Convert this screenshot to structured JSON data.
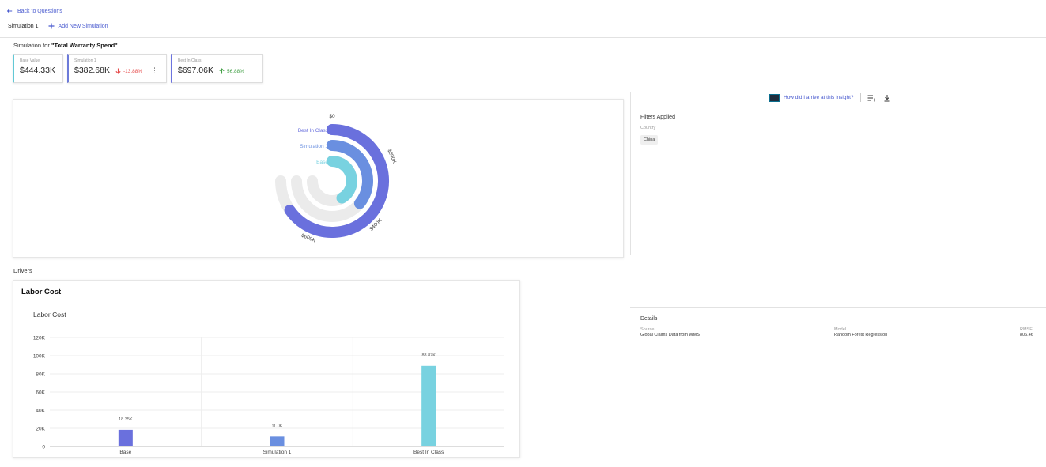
{
  "nav": {
    "back_label": "Back to Questions"
  },
  "tabs": {
    "active": "Simulation 1",
    "add_label": "Add New Simulation"
  },
  "simulation": {
    "prefix": "Simulation for ",
    "metric": "\"Total Warranty Spend\""
  },
  "kpis": [
    {
      "label": "Base Value",
      "value": "$444.33K",
      "change": "",
      "accent": "#62c9d6"
    },
    {
      "label": "Simulation 1",
      "value": "$382.68K",
      "change": "-13.88%",
      "direction": "down",
      "accent": "#6c7ad9"
    },
    {
      "label": "Best In Class",
      "value": "$697.06K",
      "change": "56.88%",
      "direction": "up",
      "accent": "#6c74df"
    }
  ],
  "insight": {
    "link_label": "How did I arrive at this insight?"
  },
  "filters": {
    "heading": "Filters Applied",
    "key": "Country",
    "value": "China"
  },
  "drivers_label": "Drivers",
  "details": {
    "heading": "Details",
    "source_key": "Source",
    "source_value": "Global Claims Data from WMS",
    "model_key": "Model",
    "model_value": "Random Forest Regression",
    "rmse_key": "RMSE",
    "rmse_value": "806.46"
  },
  "driver_card": {
    "title": "Labor Cost"
  },
  "colors": {
    "base": "#78d2e0",
    "simulation": "#6a8fe0",
    "best": "#6a70dd",
    "track": "#ebebeb",
    "link": "#4a5bcf"
  },
  "chart_data": [
    {
      "type": "radial-bar",
      "series": [
        {
          "name": "Best In Class",
          "value": 697.06
        },
        {
          "name": "Simulation 1",
          "value": 382.68
        },
        {
          "name": "Base",
          "value": 444.33
        }
      ],
      "axis_labels": [
        "$0",
        "$200K",
        "$400K",
        "$600K"
      ],
      "axis_max": 800
    },
    {
      "type": "bar",
      "title": "Labor Cost",
      "categories": [
        "Base",
        "Simulation 1",
        "Best In Class"
      ],
      "values": [
        18.35,
        11.0,
        88.87
      ],
      "data_labels": [
        "18.35K",
        "11.0K",
        "88.87K"
      ],
      "colors": [
        "#6a70dd",
        "#6a8fe0",
        "#78d2e0"
      ],
      "yticks": [
        "0",
        "20K",
        "40K",
        "60K",
        "80K",
        "100K",
        "120K"
      ],
      "ylim": [
        0,
        120
      ],
      "grid": true
    }
  ]
}
